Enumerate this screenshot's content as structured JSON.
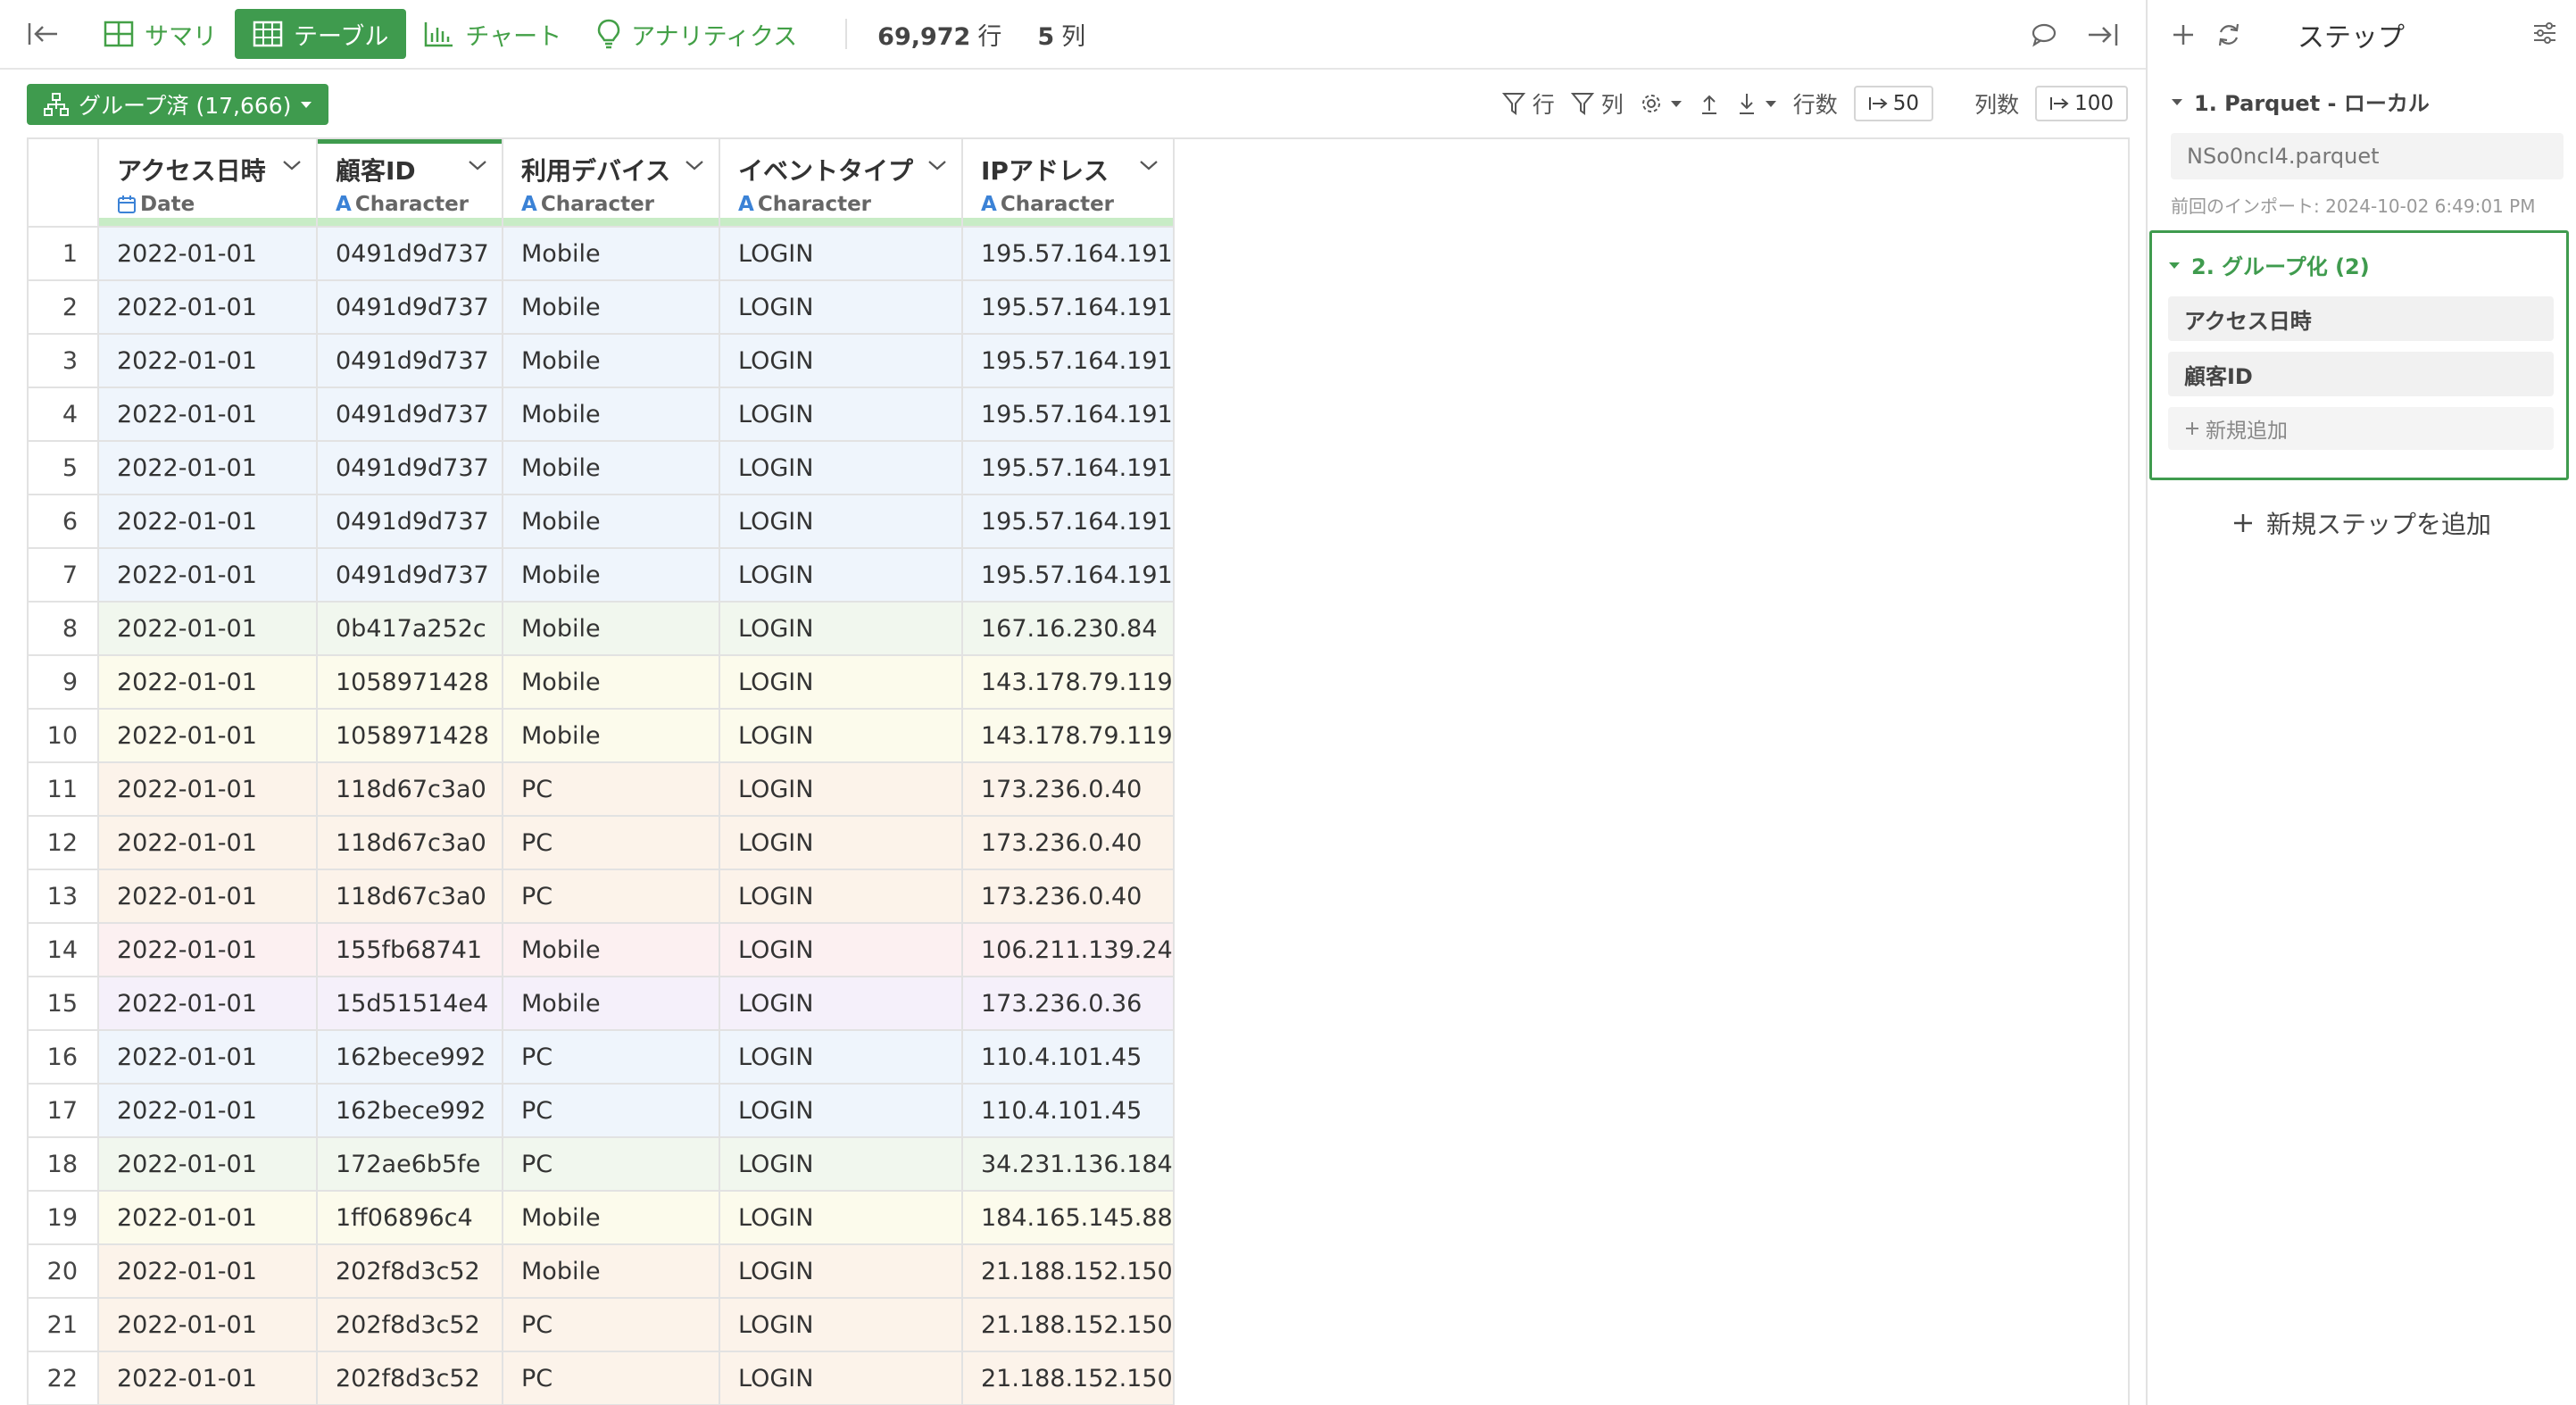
{
  "topbar": {
    "tabs": [
      {
        "label": "サマリ",
        "icon": "summary-grid-icon"
      },
      {
        "label": "テーブル",
        "icon": "table-icon",
        "active": true
      },
      {
        "label": "チャート",
        "icon": "bar-chart-icon"
      },
      {
        "label": "アナリティクス",
        "icon": "lightbulb-icon"
      }
    ],
    "row_count": "69,972",
    "row_unit": "行",
    "col_count": "5",
    "col_unit": "列"
  },
  "subbar": {
    "group_button": "グループ済 (17,666)",
    "filter_rows": "行",
    "filter_cols": "列",
    "rows_label": "行数",
    "rows_value": "50",
    "cols_label": "列数",
    "cols_value": "100"
  },
  "table": {
    "columns": [
      {
        "name": "アクセス日時",
        "type": "Date"
      },
      {
        "name": "顧客ID",
        "type": "Character"
      },
      {
        "name": "利用デバイス",
        "type": "Character"
      },
      {
        "name": "イベントタイプ",
        "type": "Character"
      },
      {
        "name": "IPアドレス",
        "type": "Character"
      }
    ],
    "rows": [
      {
        "n": "1",
        "group": 0,
        "cells": [
          "2022-01-01",
          "0491d9d737",
          "Mobile",
          "LOGIN",
          "195.57.164.191"
        ]
      },
      {
        "n": "2",
        "group": 0,
        "cells": [
          "2022-01-01",
          "0491d9d737",
          "Mobile",
          "LOGIN",
          "195.57.164.191"
        ]
      },
      {
        "n": "3",
        "group": 0,
        "cells": [
          "2022-01-01",
          "0491d9d737",
          "Mobile",
          "LOGIN",
          "195.57.164.191"
        ]
      },
      {
        "n": "4",
        "group": 0,
        "cells": [
          "2022-01-01",
          "0491d9d737",
          "Mobile",
          "LOGIN",
          "195.57.164.191"
        ]
      },
      {
        "n": "5",
        "group": 0,
        "cells": [
          "2022-01-01",
          "0491d9d737",
          "Mobile",
          "LOGIN",
          "195.57.164.191"
        ]
      },
      {
        "n": "6",
        "group": 0,
        "cells": [
          "2022-01-01",
          "0491d9d737",
          "Mobile",
          "LOGIN",
          "195.57.164.191"
        ]
      },
      {
        "n": "7",
        "group": 0,
        "cells": [
          "2022-01-01",
          "0491d9d737",
          "Mobile",
          "LOGIN",
          "195.57.164.191"
        ]
      },
      {
        "n": "8",
        "group": 1,
        "cells": [
          "2022-01-01",
          "0b417a252c",
          "Mobile",
          "LOGIN",
          "167.16.230.84"
        ]
      },
      {
        "n": "9",
        "group": 2,
        "cells": [
          "2022-01-01",
          "1058971428",
          "Mobile",
          "LOGIN",
          "143.178.79.119"
        ]
      },
      {
        "n": "10",
        "group": 2,
        "cells": [
          "2022-01-01",
          "1058971428",
          "Mobile",
          "LOGIN",
          "143.178.79.119"
        ]
      },
      {
        "n": "11",
        "group": 3,
        "cells": [
          "2022-01-01",
          "118d67c3a0",
          "PC",
          "LOGIN",
          "173.236.0.40"
        ]
      },
      {
        "n": "12",
        "group": 3,
        "cells": [
          "2022-01-01",
          "118d67c3a0",
          "PC",
          "LOGIN",
          "173.236.0.40"
        ]
      },
      {
        "n": "13",
        "group": 3,
        "cells": [
          "2022-01-01",
          "118d67c3a0",
          "PC",
          "LOGIN",
          "173.236.0.40"
        ]
      },
      {
        "n": "14",
        "group": 4,
        "cells": [
          "2022-01-01",
          "155fb68741",
          "Mobile",
          "LOGIN",
          "106.211.139.24"
        ]
      },
      {
        "n": "15",
        "group": 5,
        "cells": [
          "2022-01-01",
          "15d51514e4",
          "Mobile",
          "LOGIN",
          "173.236.0.36"
        ]
      },
      {
        "n": "16",
        "group": 0,
        "cells": [
          "2022-01-01",
          "162bece992",
          "PC",
          "LOGIN",
          "110.4.101.45"
        ]
      },
      {
        "n": "17",
        "group": 0,
        "cells": [
          "2022-01-01",
          "162bece992",
          "PC",
          "LOGIN",
          "110.4.101.45"
        ]
      },
      {
        "n": "18",
        "group": 1,
        "cells": [
          "2022-01-01",
          "172ae6b5fe",
          "PC",
          "LOGIN",
          "34.231.136.184"
        ]
      },
      {
        "n": "19",
        "group": 2,
        "cells": [
          "2022-01-01",
          "1ff06896c4",
          "Mobile",
          "LOGIN",
          "184.165.145.88"
        ]
      },
      {
        "n": "20",
        "group": 3,
        "cells": [
          "2022-01-01",
          "202f8d3c52",
          "Mobile",
          "LOGIN",
          "21.188.152.150"
        ]
      },
      {
        "n": "21",
        "group": 3,
        "cells": [
          "2022-01-01",
          "202f8d3c52",
          "PC",
          "LOGIN",
          "21.188.152.150"
        ]
      },
      {
        "n": "22",
        "group": 3,
        "cells": [
          "2022-01-01",
          "202f8d3c52",
          "PC",
          "LOGIN",
          "21.188.152.150"
        ]
      }
    ]
  },
  "panel": {
    "title": "ステップ",
    "step1": {
      "title": "1. Parquet - ローカル",
      "file": "NSo0ncI4.parquet",
      "imported": "前回のインポート: 2024-10-02 6:49:01 PM"
    },
    "step2": {
      "title": "2. グループ化 (2)",
      "items": [
        "アクセス日時",
        "顧客ID"
      ],
      "add_label": "新規追加"
    },
    "add_step": "新規ステップを追加"
  },
  "colors": {
    "accent": "#3f9b4e",
    "group_tints": [
      "#eff5fc",
      "#f1f7ee",
      "#fcfbec",
      "#fcf3ea",
      "#fcf0f1",
      "#f5f0fa"
    ]
  }
}
